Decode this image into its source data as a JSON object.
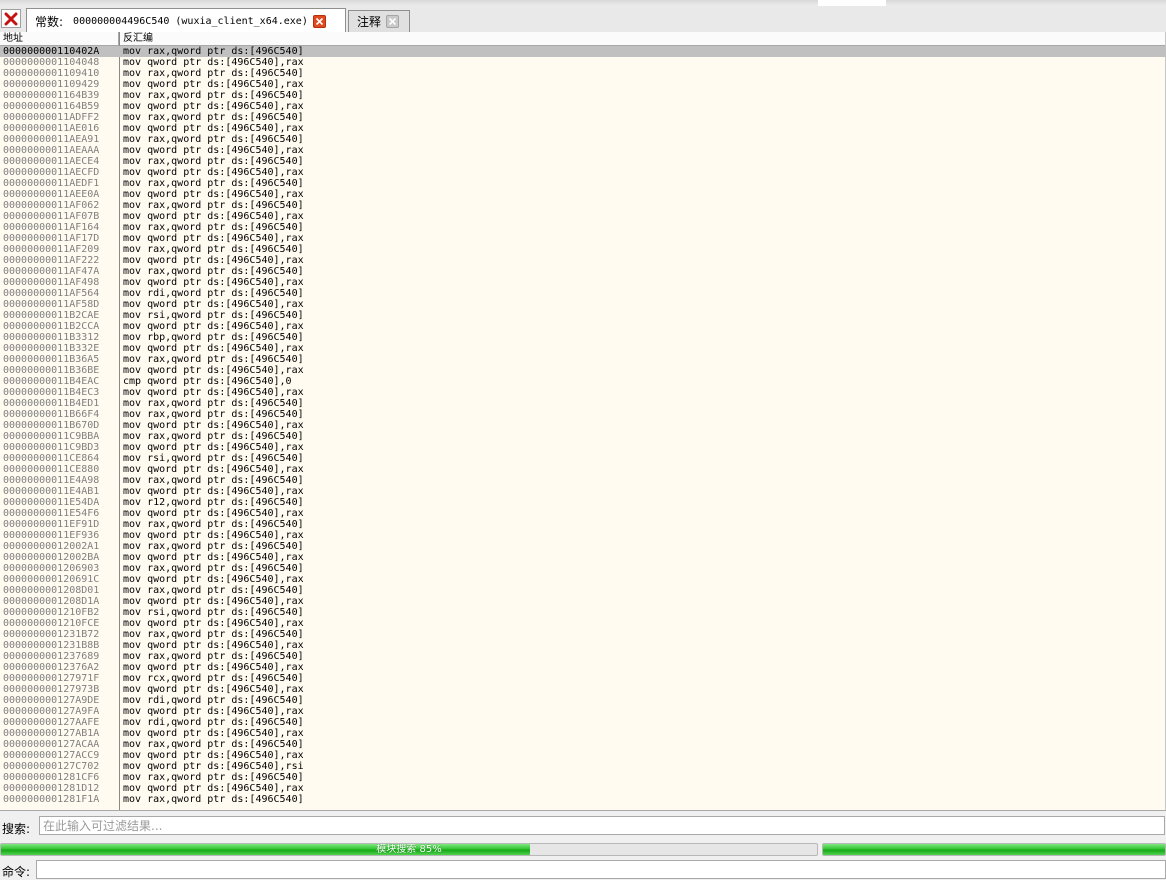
{
  "tabs": {
    "active_label": "常数:",
    "active_title": "000000004496C540 (wuxia_client_x64.exe)",
    "inactive_label": "注释"
  },
  "columns": {
    "address": "地址",
    "disassembly": "反汇编"
  },
  "rows": [
    {
      "addr": "000000000110402A",
      "asm": "mov rax,qword ptr ds:[496C540]",
      "selected": true
    },
    {
      "addr": "0000000001104048",
      "asm": "mov qword ptr ds:[496C540],rax"
    },
    {
      "addr": "0000000001109410",
      "asm": "mov rax,qword ptr ds:[496C540]"
    },
    {
      "addr": "0000000001109429",
      "asm": "mov qword ptr ds:[496C540],rax"
    },
    {
      "addr": "0000000001164B39",
      "asm": "mov rax,qword ptr ds:[496C540]"
    },
    {
      "addr": "0000000001164B59",
      "asm": "mov qword ptr ds:[496C540],rax"
    },
    {
      "addr": "00000000011ADFF2",
      "asm": "mov rax,qword ptr ds:[496C540]"
    },
    {
      "addr": "00000000011AE016",
      "asm": "mov qword ptr ds:[496C540],rax"
    },
    {
      "addr": "00000000011AEA91",
      "asm": "mov rax,qword ptr ds:[496C540]"
    },
    {
      "addr": "00000000011AEAAA",
      "asm": "mov qword ptr ds:[496C540],rax"
    },
    {
      "addr": "00000000011AECE4",
      "asm": "mov rax,qword ptr ds:[496C540]"
    },
    {
      "addr": "00000000011AECFD",
      "asm": "mov qword ptr ds:[496C540],rax"
    },
    {
      "addr": "00000000011AEDF1",
      "asm": "mov rax,qword ptr ds:[496C540]"
    },
    {
      "addr": "00000000011AEE0A",
      "asm": "mov qword ptr ds:[496C540],rax"
    },
    {
      "addr": "00000000011AF062",
      "asm": "mov rax,qword ptr ds:[496C540]"
    },
    {
      "addr": "00000000011AF07B",
      "asm": "mov qword ptr ds:[496C540],rax"
    },
    {
      "addr": "00000000011AF164",
      "asm": "mov rax,qword ptr ds:[496C540]"
    },
    {
      "addr": "00000000011AF17D",
      "asm": "mov qword ptr ds:[496C540],rax"
    },
    {
      "addr": "00000000011AF209",
      "asm": "mov rax,qword ptr ds:[496C540]"
    },
    {
      "addr": "00000000011AF222",
      "asm": "mov qword ptr ds:[496C540],rax"
    },
    {
      "addr": "00000000011AF47A",
      "asm": "mov rax,qword ptr ds:[496C540]"
    },
    {
      "addr": "00000000011AF498",
      "asm": "mov qword ptr ds:[496C540],rax"
    },
    {
      "addr": "00000000011AF564",
      "asm": "mov rdi,qword ptr ds:[496C540]"
    },
    {
      "addr": "00000000011AF58D",
      "asm": "mov qword ptr ds:[496C540],rax"
    },
    {
      "addr": "00000000011B2CAE",
      "asm": "mov rsi,qword ptr ds:[496C540]"
    },
    {
      "addr": "00000000011B2CCA",
      "asm": "mov qword ptr ds:[496C540],rax"
    },
    {
      "addr": "00000000011B3312",
      "asm": "mov rbp,qword ptr ds:[496C540]"
    },
    {
      "addr": "00000000011B332E",
      "asm": "mov qword ptr ds:[496C540],rax"
    },
    {
      "addr": "00000000011B36A5",
      "asm": "mov rax,qword ptr ds:[496C540]"
    },
    {
      "addr": "00000000011B36BE",
      "asm": "mov qword ptr ds:[496C540],rax"
    },
    {
      "addr": "00000000011B4EAC",
      "asm": "cmp qword ptr ds:[496C540],0"
    },
    {
      "addr": "00000000011B4EC3",
      "asm": "mov qword ptr ds:[496C540],rax"
    },
    {
      "addr": "00000000011B4ED1",
      "asm": "mov rax,qword ptr ds:[496C540]"
    },
    {
      "addr": "00000000011B66F4",
      "asm": "mov rax,qword ptr ds:[496C540]"
    },
    {
      "addr": "00000000011B670D",
      "asm": "mov qword ptr ds:[496C540],rax"
    },
    {
      "addr": "00000000011C9BBA",
      "asm": "mov rax,qword ptr ds:[496C540]"
    },
    {
      "addr": "00000000011C9BD3",
      "asm": "mov qword ptr ds:[496C540],rax"
    },
    {
      "addr": "00000000011CE864",
      "asm": "mov rsi,qword ptr ds:[496C540]"
    },
    {
      "addr": "00000000011CE880",
      "asm": "mov qword ptr ds:[496C540],rax"
    },
    {
      "addr": "00000000011E4A98",
      "asm": "mov rax,qword ptr ds:[496C540]"
    },
    {
      "addr": "00000000011E4AB1",
      "asm": "mov qword ptr ds:[496C540],rax"
    },
    {
      "addr": "00000000011E54DA",
      "asm": "mov r12,qword ptr ds:[496C540]"
    },
    {
      "addr": "00000000011E54F6",
      "asm": "mov qword ptr ds:[496C540],rax"
    },
    {
      "addr": "00000000011EF91D",
      "asm": "mov rax,qword ptr ds:[496C540]"
    },
    {
      "addr": "00000000011EF936",
      "asm": "mov qword ptr ds:[496C540],rax"
    },
    {
      "addr": "00000000012002A1",
      "asm": "mov rax,qword ptr ds:[496C540]"
    },
    {
      "addr": "00000000012002BA",
      "asm": "mov qword ptr ds:[496C540],rax"
    },
    {
      "addr": "0000000001206903",
      "asm": "mov rax,qword ptr ds:[496C540]"
    },
    {
      "addr": "000000000120691C",
      "asm": "mov qword ptr ds:[496C540],rax"
    },
    {
      "addr": "0000000001208D01",
      "asm": "mov rax,qword ptr ds:[496C540]"
    },
    {
      "addr": "0000000001208D1A",
      "asm": "mov qword ptr ds:[496C540],rax"
    },
    {
      "addr": "0000000001210FB2",
      "asm": "mov rsi,qword ptr ds:[496C540]"
    },
    {
      "addr": "0000000001210FCE",
      "asm": "mov qword ptr ds:[496C540],rax"
    },
    {
      "addr": "0000000001231B72",
      "asm": "mov rax,qword ptr ds:[496C540]"
    },
    {
      "addr": "0000000001231B8B",
      "asm": "mov qword ptr ds:[496C540],rax"
    },
    {
      "addr": "0000000001237689",
      "asm": "mov rax,qword ptr ds:[496C540]"
    },
    {
      "addr": "00000000012376A2",
      "asm": "mov qword ptr ds:[496C540],rax"
    },
    {
      "addr": "000000000127971F",
      "asm": "mov rcx,qword ptr ds:[496C540]"
    },
    {
      "addr": "000000000127973B",
      "asm": "mov qword ptr ds:[496C540],rax"
    },
    {
      "addr": "000000000127A9DE",
      "asm": "mov rdi,qword ptr ds:[496C540]"
    },
    {
      "addr": "000000000127A9FA",
      "asm": "mov qword ptr ds:[496C540],rax"
    },
    {
      "addr": "000000000127AAFE",
      "asm": "mov rdi,qword ptr ds:[496C540]"
    },
    {
      "addr": "000000000127AB1A",
      "asm": "mov qword ptr ds:[496C540],rax"
    },
    {
      "addr": "000000000127ACAA",
      "asm": "mov rax,qword ptr ds:[496C540]"
    },
    {
      "addr": "000000000127ACC9",
      "asm": "mov qword ptr ds:[496C540],rax"
    },
    {
      "addr": "000000000127C702",
      "asm": "mov qword ptr ds:[496C540],rsi"
    },
    {
      "addr": "0000000001281CF6",
      "asm": "mov rax,qword ptr ds:[496C540]"
    },
    {
      "addr": "0000000001281D12",
      "asm": "mov qword ptr ds:[496C540],rax"
    },
    {
      "addr": "0000000001281F1A",
      "asm": "mov rax,qword ptr ds:[496C540]"
    }
  ],
  "search": {
    "label": "搜索:",
    "placeholder": "在此输入可过滤结果..."
  },
  "progress": {
    "label": "模块搜索 85%",
    "main_fraction": 0.648,
    "side_fraction": 1.0
  },
  "command": {
    "label": "命令:"
  },
  "colors": {
    "accent_green": "#15a815",
    "row_bg": "#fffbf0",
    "selected_row": "#c0c0c0",
    "close_red": "#e04a1e"
  }
}
